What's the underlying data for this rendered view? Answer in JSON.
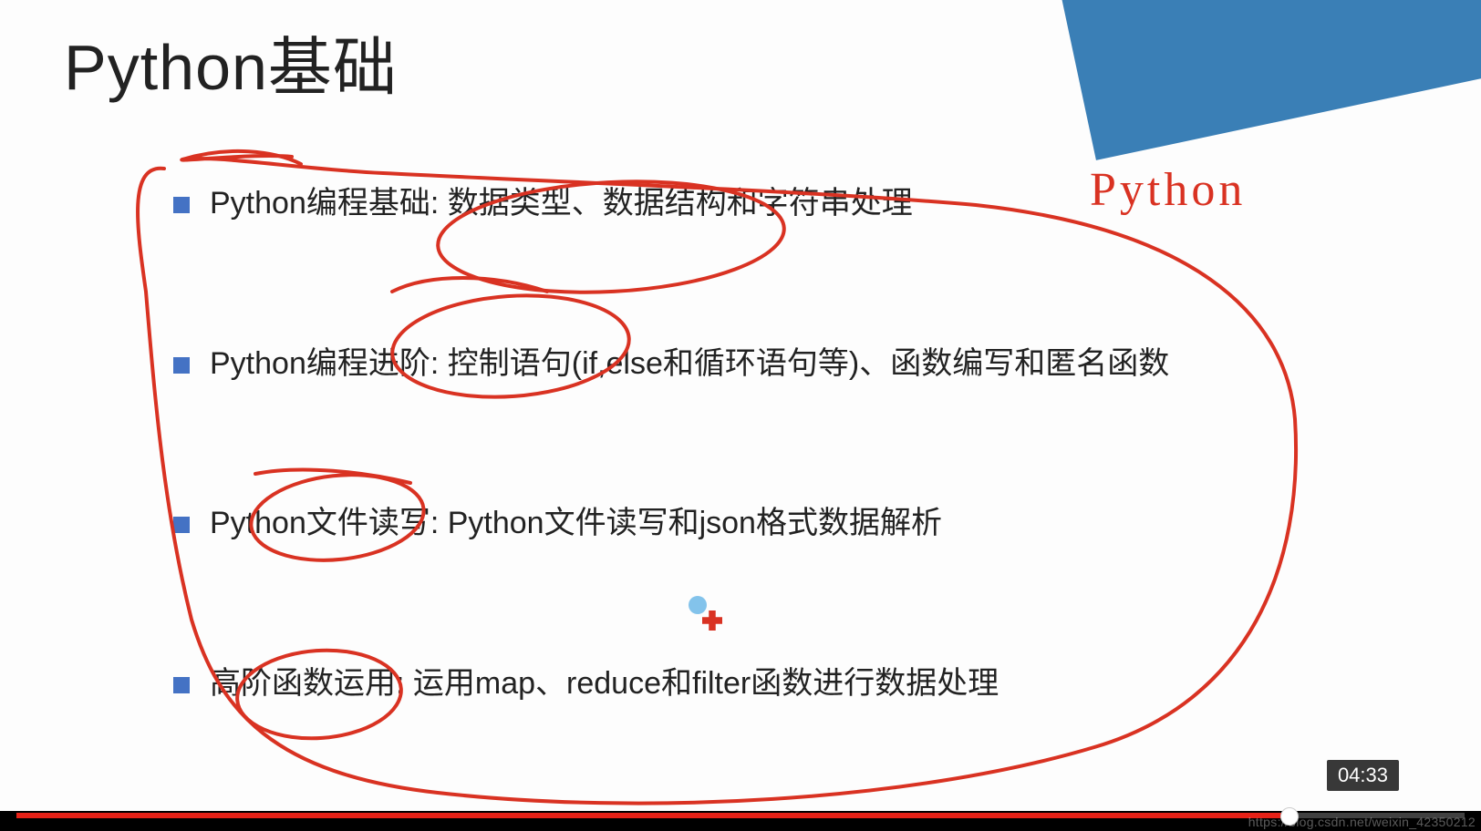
{
  "slide": {
    "title": "Python基础",
    "bullets": [
      "Python编程基础:  数据类型、数据结构和字符串处理",
      "Python编程进阶:  控制语句(if,else和循环语句等)、函数编写和匿名函数",
      "Python文件读写:  Python文件读写和json格式数据解析",
      "高阶函数运用:  运用map、reduce和filter函数进行数据处理"
    ],
    "handwritten": "Python"
  },
  "player": {
    "time": "04:33",
    "watermark": "https://blog.csdn.net/weixin_42350212"
  },
  "colors": {
    "accent_blue": "#4472c4",
    "banner_blue": "#3a7fb6",
    "banner_dark": "#0e1a3a",
    "annotation_red": "#d93222",
    "progress_red": "#e62117"
  }
}
